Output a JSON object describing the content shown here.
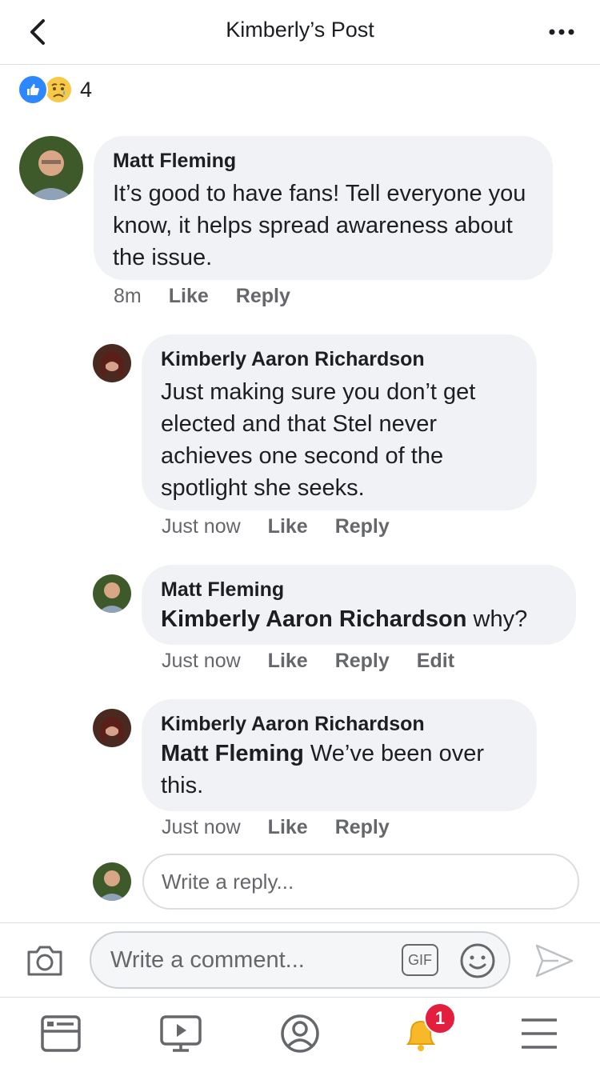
{
  "header": {
    "title": "Kimberly’s Post"
  },
  "reactions": {
    "count": "4"
  },
  "comments": [
    {
      "author": "Matt Fleming",
      "text": "It’s good to have fans! Tell everyone you know, it helps spread awareness about the issue.",
      "time": "8m",
      "like": "Like",
      "reply": "Reply"
    },
    {
      "author": "Kimberly Aaron Richardson",
      "text": "Just making sure you don’t get elected and that Stel never achieves one second of the spotlight she seeks.",
      "time": "Just now",
      "like": "Like",
      "reply": "Reply"
    },
    {
      "author": "Matt Fleming",
      "mention": "Kimberly Aaron Richardson",
      "text": " why?",
      "time": "Just now",
      "like": "Like",
      "reply": "Reply",
      "edit": "Edit"
    },
    {
      "author": "Kimberly Aaron Richardson",
      "mention": "Matt Fleming",
      "text": " We’ve been over this.",
      "time": "Just now",
      "like": "Like",
      "reply": "Reply"
    }
  ],
  "reply_box": {
    "placeholder": "Write a reply..."
  },
  "composer": {
    "placeholder": "Write a comment...",
    "gif_label": "GIF"
  },
  "tabbar": {
    "notification_badge": "1"
  },
  "colors": {
    "accent": "#2d88ff",
    "badge": "#e41e3f",
    "bubble": "#f0f2f5",
    "secondary_text": "#65676b"
  }
}
